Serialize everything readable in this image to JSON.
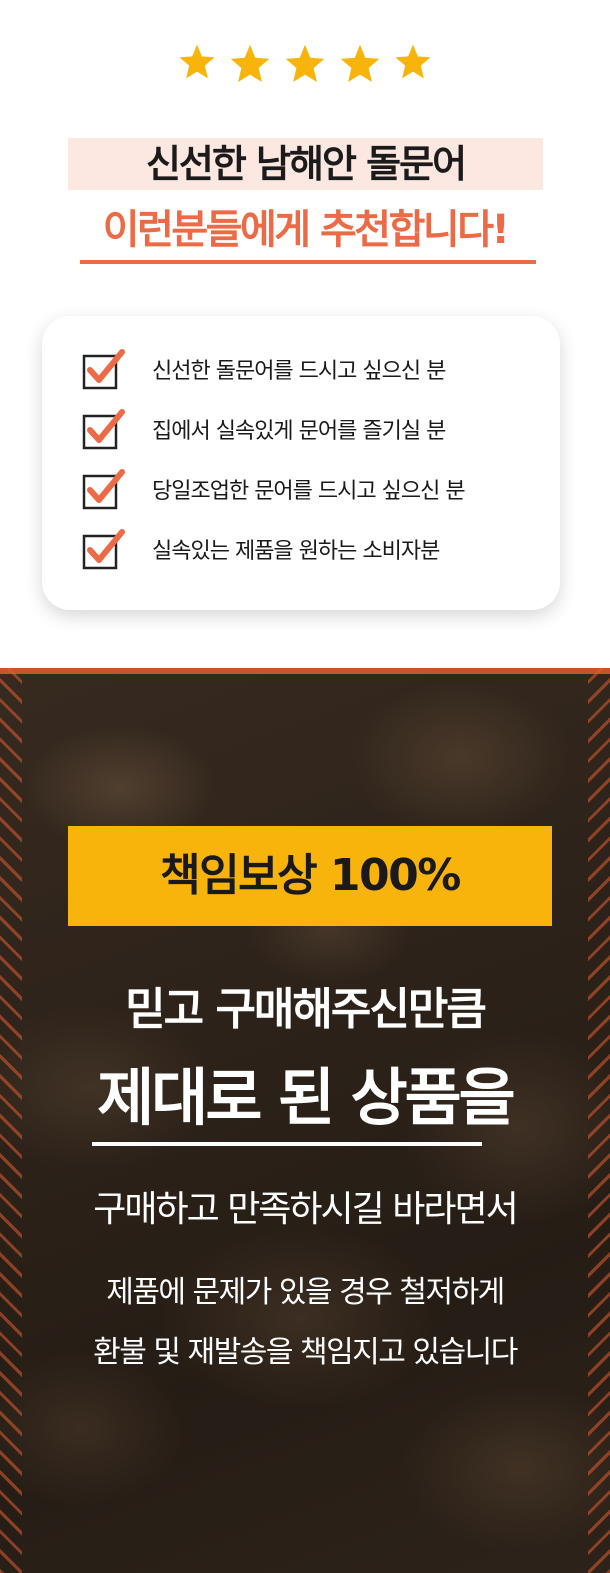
{
  "rating": {
    "stars": 5,
    "star_color": "#f9b40b",
    "icon": "star-icon"
  },
  "headline": {
    "line1": "신선한 남해안 돌문어",
    "line2": "이런분들에게 추천합니다!",
    "highlight_bg": "#fde7e1",
    "accent_color": "#ec6a45"
  },
  "recommend_list": {
    "check_color": "#ec6a45",
    "icon": "checkbox-checked-icon",
    "items": [
      "신선한 돌문어를 드시고 싶으신 분",
      "집에서 실속있게 문어를 즐기실 분",
      "당일조업한 문어를 드시고 싶으신 분",
      "실속있는 제품을 원하는 소비자분"
    ]
  },
  "guarantee": {
    "banner": "책임보상 100%",
    "banner_color": "#f9b40b",
    "line1": "믿고 구매해주신만큼",
    "line2": "제대로 된 상품을",
    "line3": "구매하고 만족하시길 바라면서",
    "line4": "제품에 문제가 있을 경우 철저하게",
    "line5": "환불 및 재발송을 책임지고 있습니다"
  }
}
